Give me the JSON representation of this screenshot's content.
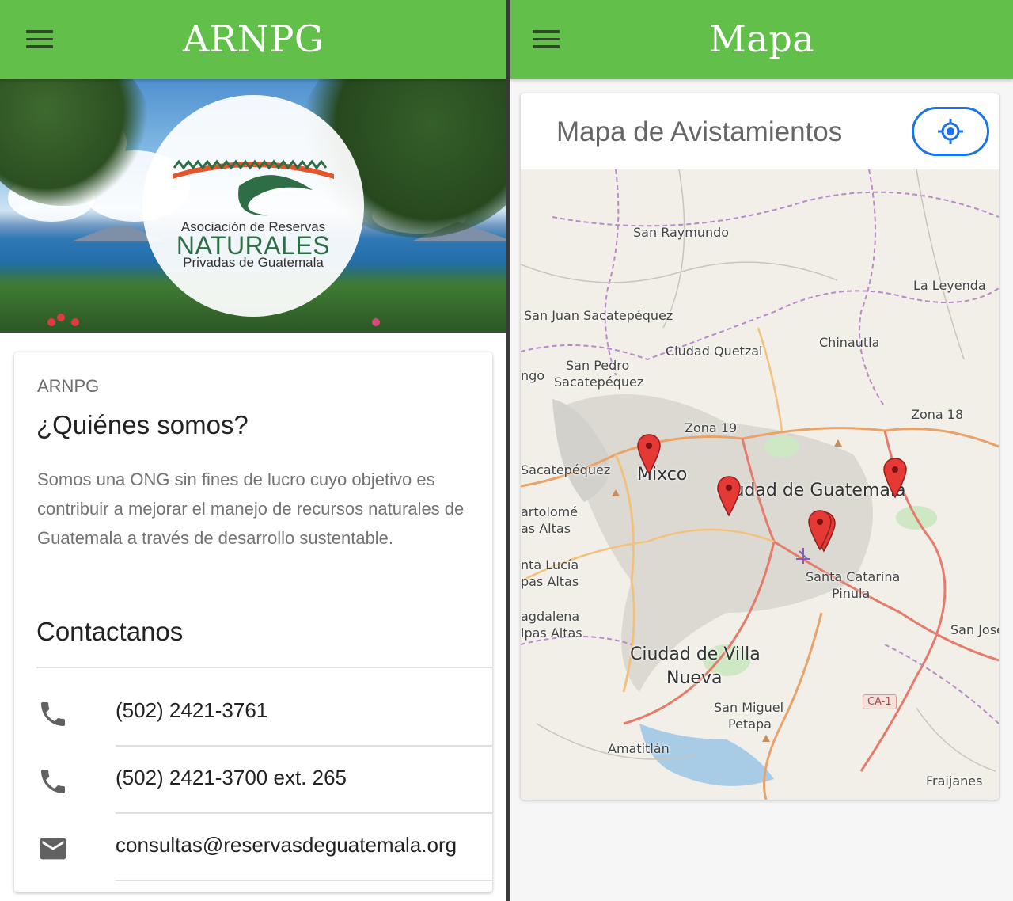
{
  "left": {
    "appbar": {
      "title": "ARNPG"
    },
    "logo": {
      "line1": "Asociación de Reservas",
      "line2": "NATURALES",
      "line3": "Privadas de Guatemala"
    },
    "card": {
      "overline": "ARNPG",
      "title": "¿Quiénes somos?",
      "description": "Somos una ONG sin fines de lucro cuyo objetivo es contribuir a mejorar el manejo de recursos naturales de Guatemala a través de desarrollo sustentable.",
      "contact_title": "Contactanos",
      "contacts": [
        {
          "icon": "phone-icon",
          "text": "(502) 2421-3761"
        },
        {
          "icon": "phone-icon",
          "text": "(502) 2421-3700 ext. 265"
        },
        {
          "icon": "email-icon",
          "text": "consultas@reservasdeguatemala.org"
        }
      ]
    }
  },
  "right": {
    "appbar": {
      "title": "Mapa"
    },
    "card": {
      "title": "Mapa de Avistamientos",
      "locate_icon": "my-location-icon"
    },
    "map_labels": [
      "San Raymundo",
      "La Leyenda",
      "San Juan Sacatepéquez",
      "Ciudad Quetzal",
      "Chinautla",
      "San Pedro",
      "Sacatepéquez",
      "ngo",
      "Zona 19",
      "Zona 18",
      "Sacatepéquez",
      "Mixco",
      "Ciudad de Guatemala",
      "artolomé",
      "as Altas",
      "nta Lucía",
      "pas Altas",
      "Santa Catarina",
      "Pinula",
      "agdalena",
      "lpas Altas",
      "San José",
      "Ciudad de Villa",
      "Nueva",
      "San Miguel",
      "Petapa",
      "CA-1",
      "Amatitlán",
      "Fraijanes"
    ],
    "markers_count": 5
  },
  "colors": {
    "appbar": "#61bf4a",
    "accent": "#1a73e8",
    "marker": "#e53935"
  }
}
